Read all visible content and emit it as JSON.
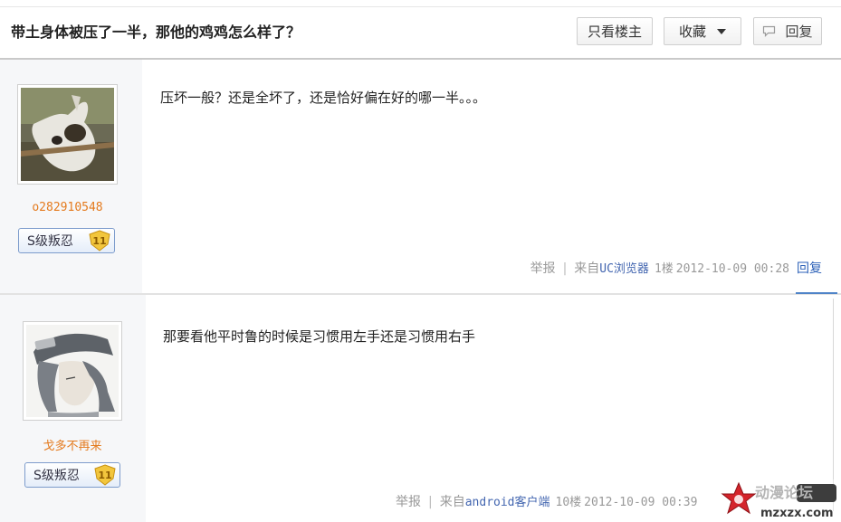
{
  "thread": {
    "title": "带土身体被压了一半，那他的鸡鸡怎么样了？"
  },
  "toolbar": {
    "only_op_label": "只看楼主",
    "favorite_label": "收藏",
    "reply_label": "回复"
  },
  "posts": [
    {
      "username": "o282910548",
      "rank_label": "S级叛忍",
      "level": "11",
      "content": "压坏一般？还是全坏了，还是恰好偏在好的哪一半。。。",
      "report_label": "举报",
      "source": "来自",
      "source_app": "UC浏览器",
      "floor": "1楼",
      "time": "2012-10-09 00:28",
      "reply_label": "回复"
    },
    {
      "username": "戈多不再来",
      "rank_label": "S级叛忍",
      "level": "11",
      "content": "那要看他平时鲁的时候是习惯用左手还是习惯用右手",
      "report_label": "举报",
      "source": "来自",
      "source_app": "android客户端",
      "floor": "10楼",
      "time": "2012-10-09 00:39"
    }
  ],
  "watermark": {
    "cn": "动漫论坛",
    "url": "mzxzx.com"
  },
  "colors": {
    "username": "#e47a1d",
    "link": "#2e62b8",
    "sidebar_bg": "#f6f7f9",
    "badge": "#f2c63d"
  },
  "icons": {
    "favorite_caret": "chevron-down-icon",
    "reply_button": "speech-bubble-icon",
    "level_badge": "shield-badge-icon"
  }
}
